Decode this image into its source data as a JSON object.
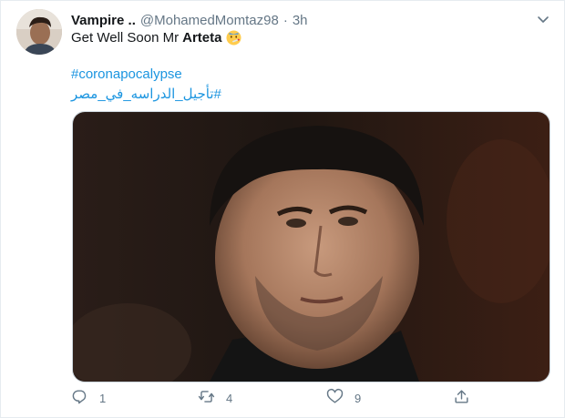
{
  "tweet": {
    "display_name": "Vampire ..",
    "handle": "@MohamedMomtaz98",
    "separator": "·",
    "time": "3h",
    "text_prefix": "Get Well Soon Mr",
    "text_bold": "Arteta",
    "emoji_icon": "face-with-thermometer-icon",
    "hashtags": [
      "#coronapocalypse",
      "#تأجيل_الدراسه_في_مصر"
    ]
  },
  "media": {
    "description": "photo-of-man-with-dark-hair-and-stubble"
  },
  "actions": {
    "reply_count": "1",
    "retweet_count": "4",
    "like_count": "9"
  },
  "colors": {
    "link": "#1b95e0",
    "muted": "#657786",
    "text": "#14171a"
  }
}
